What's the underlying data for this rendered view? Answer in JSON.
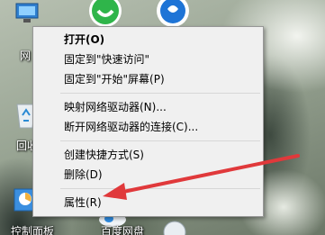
{
  "desktop": {
    "icons": [
      {
        "name": "network-icon",
        "label": "网"
      },
      {
        "name": "recycle-bin-icon",
        "label": "回收"
      },
      {
        "name": "control-panel-icon",
        "label": "控制面板"
      },
      {
        "name": "baidu-netdisk-icon",
        "label": "百度网盘"
      },
      {
        "name": "app-icon-green",
        "label": ""
      },
      {
        "name": "app-icon-blue",
        "label": ""
      },
      {
        "name": "app-icon-bottom",
        "label": ""
      }
    ]
  },
  "context_menu": {
    "items": [
      {
        "label": "打开(O)",
        "bold": true
      },
      {
        "label": "固定到\"快速访问\""
      },
      {
        "label": "固定到\"开始\"屏幕(P)"
      },
      {
        "label": "映射网络驱动器(N)..."
      },
      {
        "label": "断开网络驱动器的连接(C)..."
      },
      {
        "label": "创建快捷方式(S)"
      },
      {
        "label": "删除(D)"
      },
      {
        "label": "属性(R)"
      }
    ]
  },
  "annotation": {
    "color": "#e0393b"
  }
}
